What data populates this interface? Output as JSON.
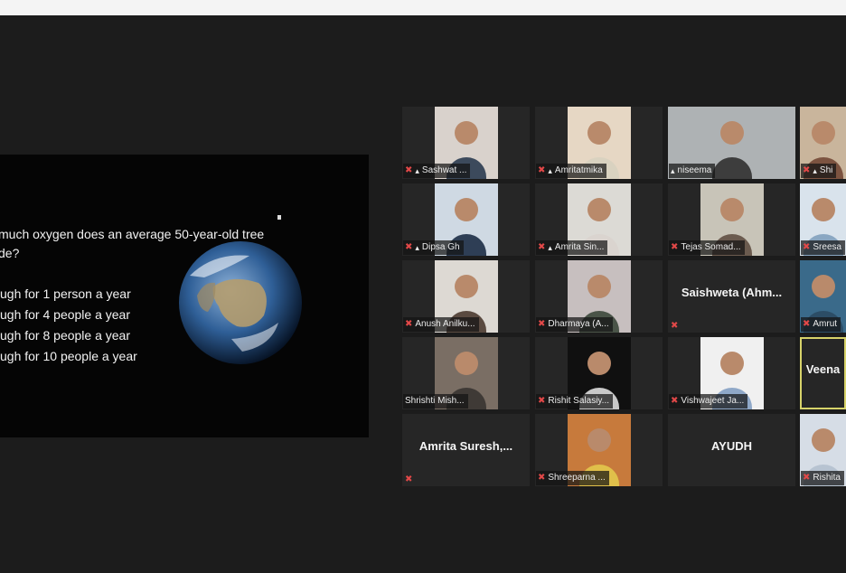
{
  "slide": {
    "question_line1": "much oxygen does an average 50-year-old tree",
    "question_line2": "de?",
    "options": [
      "ugh for 1 person a year",
      "ugh for 4 people a year",
      "ugh for 8 people a year",
      "ugh for 10 people a year"
    ]
  },
  "participants": [
    {
      "name": "Sashwat ...",
      "muted": true,
      "pinned": true,
      "video": true,
      "bg": "#d9d2cc",
      "shirt": "#3c4a5c"
    },
    {
      "name": "Amritatmika",
      "muted": true,
      "pinned": true,
      "video": true,
      "bg": "#e6d7c4",
      "shirt": "#d9d2c0"
    },
    {
      "name": "niseema",
      "muted": false,
      "pinned": true,
      "video": true,
      "bg": "#aeb2b4",
      "shirt": "#3d3d3d",
      "speaking": true
    },
    {
      "name": "Shi",
      "muted": true,
      "pinned": true,
      "video": true,
      "bg": "#c9b59c",
      "shirt": "#7c5340"
    },
    {
      "name": "Dipsa Gh",
      "muted": true,
      "pinned": true,
      "video": true,
      "bg": "#cfd9e3",
      "shirt": "#2e3e55"
    },
    {
      "name": "Amrita Sin...",
      "muted": true,
      "pinned": true,
      "video": true,
      "bg": "#dcdad5",
      "shirt": "#dad4cf"
    },
    {
      "name": "Tejas Somad...",
      "muted": true,
      "pinned": false,
      "video": true,
      "bg": "#c8c4b8",
      "shirt": "#6b5b4f"
    },
    {
      "name": "Sreesa",
      "muted": true,
      "pinned": false,
      "video": true,
      "bg": "#d9e3ec",
      "shirt": "#8aa7c2"
    },
    {
      "name": "Anush Anilku...",
      "muted": true,
      "pinned": false,
      "video": true,
      "bg": "#ddd9d3",
      "shirt": "#5a4a40"
    },
    {
      "name": "Dharmaya (A...",
      "muted": true,
      "pinned": false,
      "video": true,
      "bg": "#c7bfbf",
      "shirt": "#4a5448"
    },
    {
      "name": "Saishweta (Ahm...",
      "muted": true,
      "pinned": false,
      "video": false
    },
    {
      "name": "Amrut",
      "muted": true,
      "pinned": false,
      "video": true,
      "bg": "#3a6a8a",
      "shirt": "#2c4d66"
    },
    {
      "name": "Shrishti Mish...",
      "muted": false,
      "pinned": false,
      "video": true,
      "bg": "#7a6e64",
      "shirt": "#3f3a36"
    },
    {
      "name": "Rishit Salasiy...",
      "muted": true,
      "pinned": false,
      "video": true,
      "bg": "#101010",
      "shirt": "#c9c9c9"
    },
    {
      "name": "Vishwajeet Ja...",
      "muted": true,
      "pinned": false,
      "video": true,
      "bg": "#f0f0f0",
      "shirt": "#8fa8c8"
    },
    {
      "name": "Veena",
      "muted": false,
      "pinned": false,
      "video": false,
      "active": true
    },
    {
      "name": "Amrita Suresh,...",
      "muted": true,
      "pinned": false,
      "video": false
    },
    {
      "name": "Shreeparna ...",
      "muted": true,
      "pinned": false,
      "video": true,
      "bg": "#c77a3c",
      "shirt": "#e0c04a"
    },
    {
      "name": "AYUDH",
      "muted": false,
      "pinned": false,
      "video": false
    },
    {
      "name": "Rishita",
      "muted": true,
      "pinned": false,
      "video": true,
      "bg": "#d6dde6",
      "shirt": "#b7c3d1"
    }
  ]
}
